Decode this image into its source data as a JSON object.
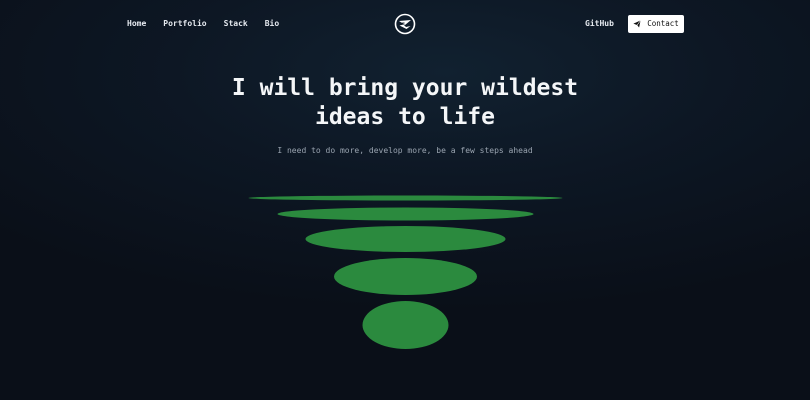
{
  "nav": {
    "links": [
      "Home",
      "Portfolio",
      "Stack",
      "Bio"
    ],
    "logo_icon": "envelope-plane-logo-icon",
    "github_label": "GitHub",
    "contact_label": "Contact",
    "contact_icon": "send-icon"
  },
  "hero": {
    "title_line1": "I will bring your wildest",
    "title_line2": "ideas to life",
    "subtitle": "I need to do more, develop more, be a few steps ahead"
  },
  "colors": {
    "background": "#0d1724",
    "accent_green": "#2b8a3e",
    "button_bg": "#ffffff",
    "text": "#f4f6f8",
    "muted_text": "#9aa4b0"
  }
}
